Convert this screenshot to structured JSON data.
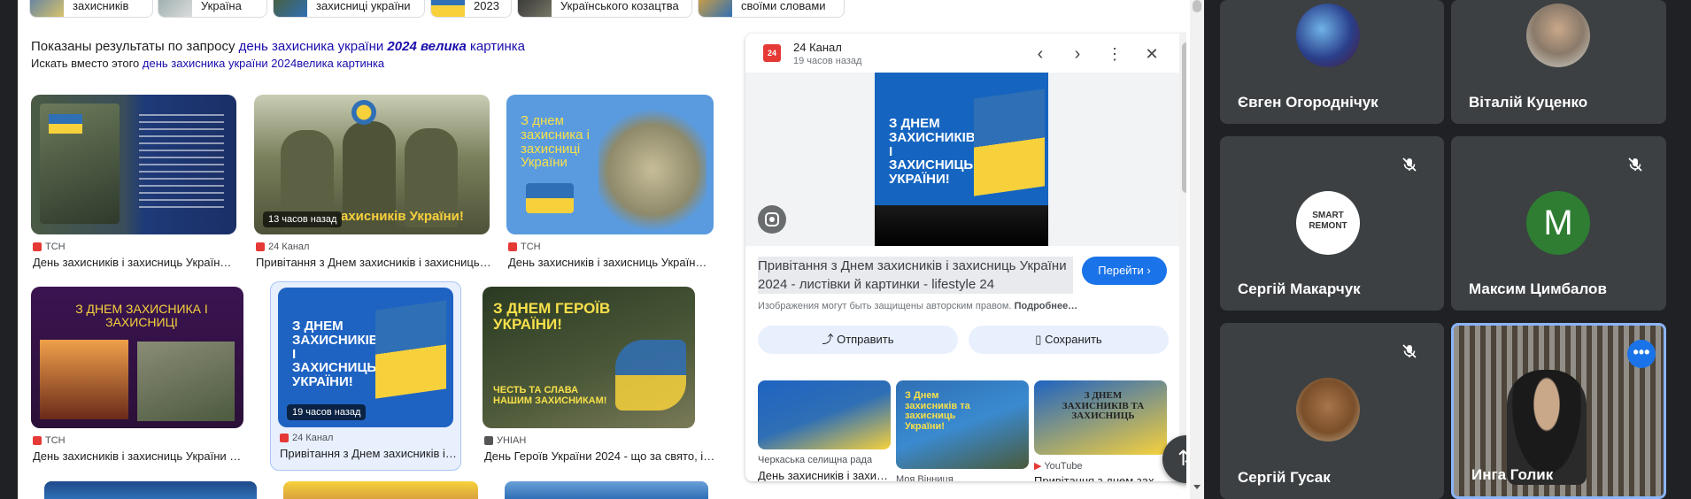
{
  "chips": [
    {
      "label": "захисників"
    },
    {
      "label": "Україна"
    },
    {
      "label": "захисниці україни"
    },
    {
      "label": "2023"
    },
    {
      "label": "Українського козацтва"
    },
    {
      "label": "своїми словами"
    }
  ],
  "query": {
    "prefix": "Показаны результаты по запросу",
    "link_part": "день захисника україни",
    "bold_part": "2024 велика",
    "suffix_part": "картинка",
    "instead_prefix": "Искать вместо этого",
    "instead_link": "день захисника україни 2024велика картинка"
  },
  "results": [
    {
      "source": "ТСН",
      "title": "День захисників і захисниць Україн…"
    },
    {
      "source": "24 Канал",
      "title": "Привітання з Днем захисників і захисниць…",
      "badge": "13 часов назад",
      "overlay": "ахисників України!"
    },
    {
      "source": "ТСН",
      "title": "День захисників і захисниць Україн…",
      "overlay": "З днем захисника і захисниці України"
    },
    {
      "source": "ТСН",
      "title": "День захисників і захисниць України 202…",
      "overlay": "З ДНЕМ ЗАХИСНИКА І ЗАХИСНИЦІ"
    },
    {
      "source": "24 Канал",
      "title": "Привітання з Днем захисників і…",
      "badge": "19 часов назад",
      "overlay": "З ДНЕМ ЗАХИСНИКІВ І ЗАХИСНИЦЬ УКРАЇНИ!"
    },
    {
      "source": "УНІАН",
      "title": "День Героїв України 2024 - що за свято, іс…",
      "overlay": "З ДНЕМ ГЕРОЇВ УКРАЇНИ!",
      "overlay2": "ЧЕСТЬ ТА СЛАВА НАШИМ ЗАХИСНИКАМ!"
    }
  ],
  "preview": {
    "source": "24 Канал",
    "time": "19 часов назад",
    "image_text": "З ДНЕМ ЗАХИСНИКІВ І ЗАХИСНИЦЬ УКРАЇНИ!",
    "title": "Привітання з Днем захисників і захисниць України 2024 - листівки й картинки - lifestyle 24",
    "go_label": "Перейти",
    "copyright": "Изображения могут быть защищены авторским правом.",
    "more": "Подробнее…",
    "share_label": "Отправить",
    "save_label": "Сохранить",
    "related": [
      {
        "source": "Черкаська селищна рада",
        "title": "День захисників і захи…"
      },
      {
        "source": "Моя Вінниця",
        "title": "",
        "overlay": "З Днем захисників та захисниць України!"
      },
      {
        "source": "YouTube",
        "title": "Привітання з днем зах…",
        "overlay": "З ДНЕМ ЗАХИСНИКІВ ТА ЗАХИСНИЦЬ"
      }
    ]
  },
  "participants": [
    {
      "name": "Євген Огороднічук",
      "muted": false
    },
    {
      "name": "Віталій Куценко",
      "muted": false
    },
    {
      "name": "Сергій Макарчук",
      "muted": true,
      "logo": "SMART REMONT"
    },
    {
      "name": "Максим Цимбалов",
      "muted": true,
      "initial": "M"
    },
    {
      "name": "Сергій Гусак",
      "muted": true
    },
    {
      "name": "Инга Голик",
      "muted": false
    }
  ],
  "colors": {
    "link": "#1a0dab",
    "accent": "#1a73e8",
    "meet_bg": "#202124",
    "tile_bg": "#3c4043",
    "avatar_green": "#2e7d32"
  }
}
